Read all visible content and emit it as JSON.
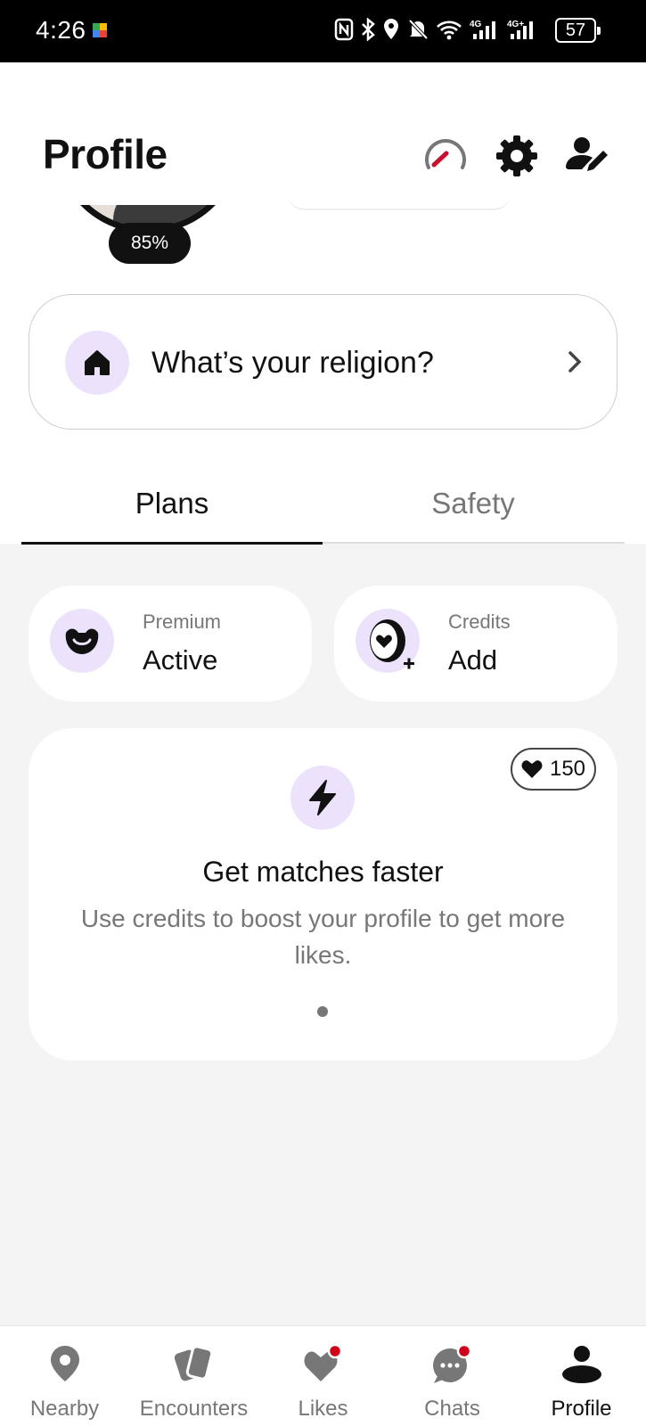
{
  "status_bar": {
    "time": "4:26",
    "battery": "57"
  },
  "header": {
    "title": "Profile"
  },
  "profile": {
    "completion": "85%"
  },
  "prompt": {
    "text": "What’s your religion?"
  },
  "tabs": [
    {
      "label": "Plans"
    },
    {
      "label": "Safety"
    }
  ],
  "plans": {
    "premium": {
      "label": "Premium",
      "value": "Active"
    },
    "credits": {
      "label": "Credits",
      "value": "Add"
    }
  },
  "boost": {
    "credits": "150",
    "title": "Get matches faster",
    "description": "Use credits to boost your profile to get more likes."
  },
  "nav": [
    {
      "label": "Nearby",
      "icon": "location-pin-icon"
    },
    {
      "label": "Encounters",
      "icon": "cards-icon"
    },
    {
      "label": "Likes",
      "icon": "heart-icon"
    },
    {
      "label": "Chats",
      "icon": "chat-bubble-icon"
    },
    {
      "label": "Profile",
      "icon": "person-icon"
    }
  ],
  "colors": {
    "accent_lavender": "#ece2fb",
    "notification_red": "#d0021b"
  }
}
